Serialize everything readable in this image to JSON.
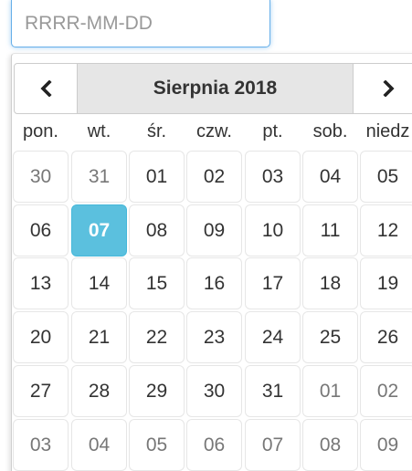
{
  "input": {
    "placeholder": "RRRR-MM-DD",
    "value": ""
  },
  "calendar": {
    "title": "Sierpnia 2018",
    "prev_icon": "chevron-left-icon",
    "next_icon": "chevron-right-icon",
    "weekdays": [
      "pon.",
      "wt.",
      "śr.",
      "czw.",
      "pt.",
      "sob.",
      "niedz"
    ],
    "weeks": [
      [
        {
          "d": "30",
          "m": "prev"
        },
        {
          "d": "31",
          "m": "prev"
        },
        {
          "d": "01",
          "m": "cur"
        },
        {
          "d": "02",
          "m": "cur"
        },
        {
          "d": "03",
          "m": "cur"
        },
        {
          "d": "04",
          "m": "cur"
        },
        {
          "d": "05",
          "m": "cur"
        }
      ],
      [
        {
          "d": "06",
          "m": "cur"
        },
        {
          "d": "07",
          "m": "cur",
          "selected": true
        },
        {
          "d": "08",
          "m": "cur"
        },
        {
          "d": "09",
          "m": "cur"
        },
        {
          "d": "10",
          "m": "cur"
        },
        {
          "d": "11",
          "m": "cur"
        },
        {
          "d": "12",
          "m": "cur"
        }
      ],
      [
        {
          "d": "13",
          "m": "cur"
        },
        {
          "d": "14",
          "m": "cur"
        },
        {
          "d": "15",
          "m": "cur"
        },
        {
          "d": "16",
          "m": "cur"
        },
        {
          "d": "17",
          "m": "cur"
        },
        {
          "d": "18",
          "m": "cur"
        },
        {
          "d": "19",
          "m": "cur"
        }
      ],
      [
        {
          "d": "20",
          "m": "cur"
        },
        {
          "d": "21",
          "m": "cur"
        },
        {
          "d": "22",
          "m": "cur"
        },
        {
          "d": "23",
          "m": "cur"
        },
        {
          "d": "24",
          "m": "cur"
        },
        {
          "d": "25",
          "m": "cur"
        },
        {
          "d": "26",
          "m": "cur"
        }
      ],
      [
        {
          "d": "27",
          "m": "cur"
        },
        {
          "d": "28",
          "m": "cur"
        },
        {
          "d": "29",
          "m": "cur"
        },
        {
          "d": "30",
          "m": "cur"
        },
        {
          "d": "31",
          "m": "cur"
        },
        {
          "d": "01",
          "m": "next"
        },
        {
          "d": "02",
          "m": "next"
        }
      ],
      [
        {
          "d": "03",
          "m": "next"
        },
        {
          "d": "04",
          "m": "next"
        },
        {
          "d": "05",
          "m": "next"
        },
        {
          "d": "06",
          "m": "next"
        },
        {
          "d": "07",
          "m": "next"
        },
        {
          "d": "08",
          "m": "next"
        },
        {
          "d": "09",
          "m": "next"
        }
      ]
    ]
  },
  "colors": {
    "selected_bg": "#5bc0de",
    "header_bg": "#e6e6e6",
    "focus_border": "#66afe9",
    "other_month_text": "#777777"
  }
}
